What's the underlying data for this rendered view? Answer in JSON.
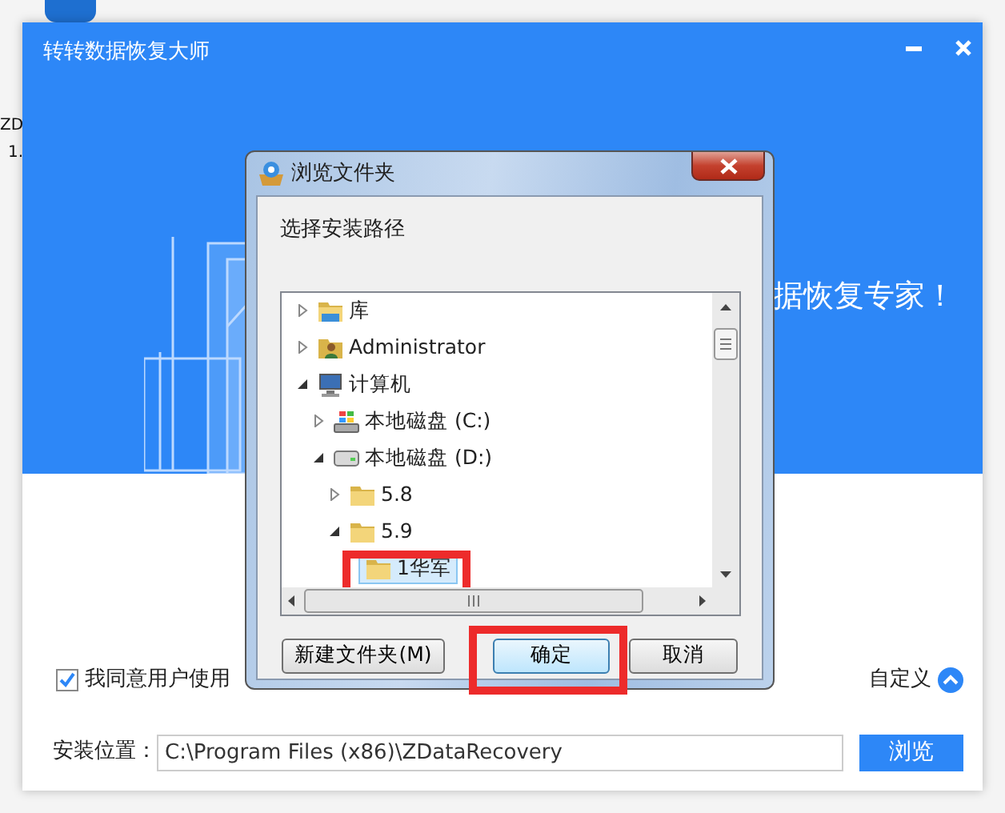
{
  "desktop": {
    "texts": [
      "ZD",
      "1."
    ]
  },
  "window": {
    "title": "转转数据恢复大师",
    "slogan": "据恢复专家！"
  },
  "agreement": {
    "checked": true,
    "label": "我同意用户使用"
  },
  "customize": {
    "label": "自定义",
    "expanded": true
  },
  "install": {
    "label": "安装位置：",
    "value": "C:\\Program Files (x86)\\ZDataRecovery",
    "button": "浏览"
  },
  "dialog": {
    "title": "浏览文件夹",
    "prompt": "选择安装路径",
    "tree": [
      {
        "label": "库",
        "kind": "library",
        "expanded": false,
        "selected": false
      },
      {
        "label": "Administrator",
        "kind": "user",
        "expanded": false,
        "selected": false
      },
      {
        "label": "计算机",
        "kind": "computer",
        "expanded": true,
        "selected": false,
        "children": [
          {
            "label": "本地磁盘 (C:)",
            "kind": "system-drive",
            "expanded": false,
            "selected": false
          },
          {
            "label": "本地磁盘 (D:)",
            "kind": "drive",
            "expanded": true,
            "selected": false,
            "children": [
              {
                "label": "5.8",
                "kind": "folder",
                "expanded": false,
                "selected": false
              },
              {
                "label": "5.9",
                "kind": "folder",
                "expanded": true,
                "selected": false,
                "children": [
                  {
                    "label": "1华军",
                    "kind": "folder",
                    "selected": true,
                    "highlighted": true
                  }
                ]
              }
            ]
          }
        ]
      }
    ],
    "buttons": [
      {
        "label": "新建文件夹(M)",
        "default": false,
        "highlighted": false
      },
      {
        "label": "确定",
        "default": true,
        "highlighted": true
      },
      {
        "label": "取消",
        "default": false,
        "highlighted": false
      }
    ]
  }
}
